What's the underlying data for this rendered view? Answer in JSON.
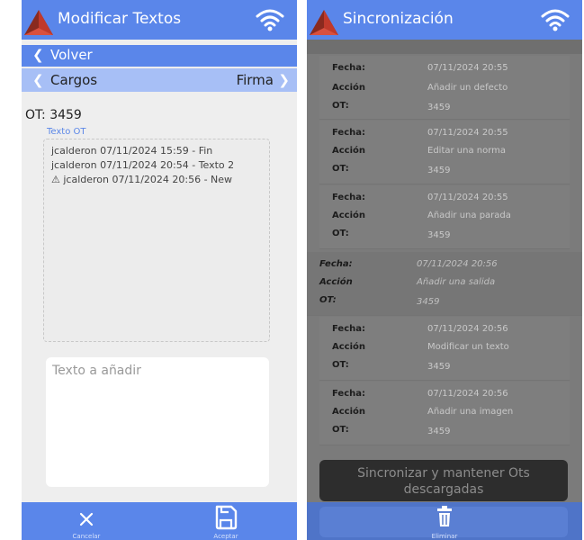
{
  "left": {
    "header_title": "Modificar Textos",
    "back_label": "Volver",
    "nav_prev": "Cargos",
    "nav_next": "Firma",
    "ot_label": "OT:",
    "ot_value": "3459",
    "texto_ot_label": "Texto OT",
    "history": [
      "jcalderon 07/11/2024 15:59 - Fin",
      "jcalderon 07/11/2024 20:54 - Texto 2",
      "⚠ jcalderon 07/11/2024 20:56 - New"
    ],
    "textarea_placeholder": "Texto a añadir",
    "cancel_label": "Cancelar",
    "accept_label": "Aceptar"
  },
  "right": {
    "header_title": "Sincronización",
    "entries": [
      {
        "k1": "Fecha:",
        "v1": "07/11/2024 20:55",
        "k2": "Acción",
        "v2": "Añadir un defecto",
        "k3": "OT:",
        "v3": "3459"
      },
      {
        "k1": "Fecha:",
        "v1": "07/11/2024 20:55",
        "k2": "Acción",
        "v2": "Editar una norma",
        "k3": "OT:",
        "v3": "3459"
      },
      {
        "k1": "Fecha:",
        "v1": "07/11/2024 20:55",
        "k2": "Acción",
        "v2": "Añadir una parada",
        "k3": "OT:",
        "v3": "3459"
      },
      {
        "k1": "Fecha:",
        "v1": "07/11/2024 20:56",
        "k2": "Acción",
        "v2": "Añadir una salida",
        "k3": "OT:",
        "v3": "3459"
      },
      {
        "k1": "Fecha:",
        "v1": "07/11/2024 20:56",
        "k2": "Acción",
        "v2": "Modificar un texto",
        "k3": "OT:",
        "v3": "3459"
      },
      {
        "k1": "Fecha:",
        "v1": "07/11/2024 20:56",
        "k2": "Acción",
        "v2": "Añadir una imagen",
        "k3": "OT:",
        "v3": "3459"
      }
    ],
    "sync_button_label": "Sincronizar y mantener Ots descargadas",
    "delete_label": "Eliminar"
  },
  "colors": {
    "primary": "#5a86ea",
    "secondary_nav": "#a7bff6",
    "logo_red": "#c0392b"
  },
  "icons": {
    "logo": "triangle-logo-icon",
    "wifi": "wifi-icon",
    "cancel": "close-icon",
    "accept": "save-icon",
    "delete": "trash-icon"
  }
}
